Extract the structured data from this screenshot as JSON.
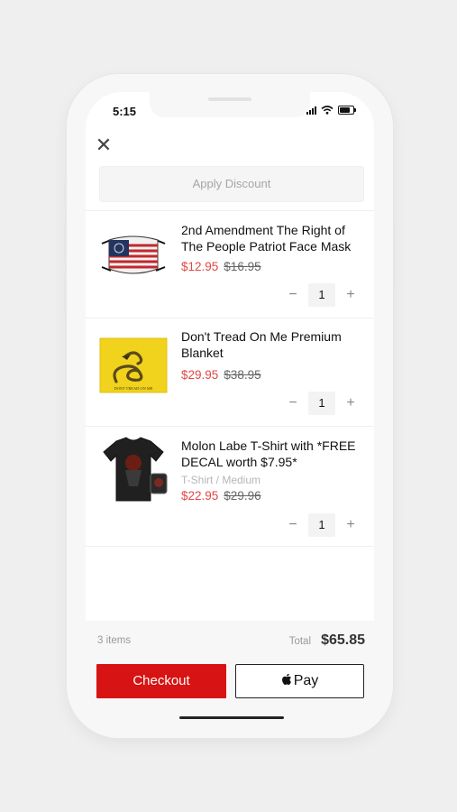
{
  "status": {
    "time": "5:15"
  },
  "discount": {
    "label": "Apply Discount"
  },
  "items": [
    {
      "title": "2nd Amendment The Right of The People Patriot Face Mask",
      "variant": "",
      "price": "$12.95",
      "compare_price": "$16.95",
      "quantity": "1"
    },
    {
      "title": "Don't Tread On Me Premium Blanket",
      "variant": "",
      "price": "$29.95",
      "compare_price": "$38.95",
      "quantity": "1",
      "image_text": "DONT TREAD ON ME"
    },
    {
      "title": "Molon Labe T-Shirt with *FREE DECAL worth $7.95*",
      "variant": "T-Shirt / Medium",
      "price": "$22.95",
      "compare_price": "$29.96",
      "quantity": "1"
    }
  ],
  "footer": {
    "items_count": "3 items",
    "total_label": "Total",
    "total_value": "$65.85",
    "checkout_label": "Checkout",
    "applepay_label": "Pay"
  },
  "colors": {
    "accent": "#d71313",
    "sale_price": "#e24545"
  },
  "icons": {
    "close": "close-icon",
    "minus": "minus-icon",
    "plus": "plus-icon",
    "apple": "apple-icon"
  }
}
